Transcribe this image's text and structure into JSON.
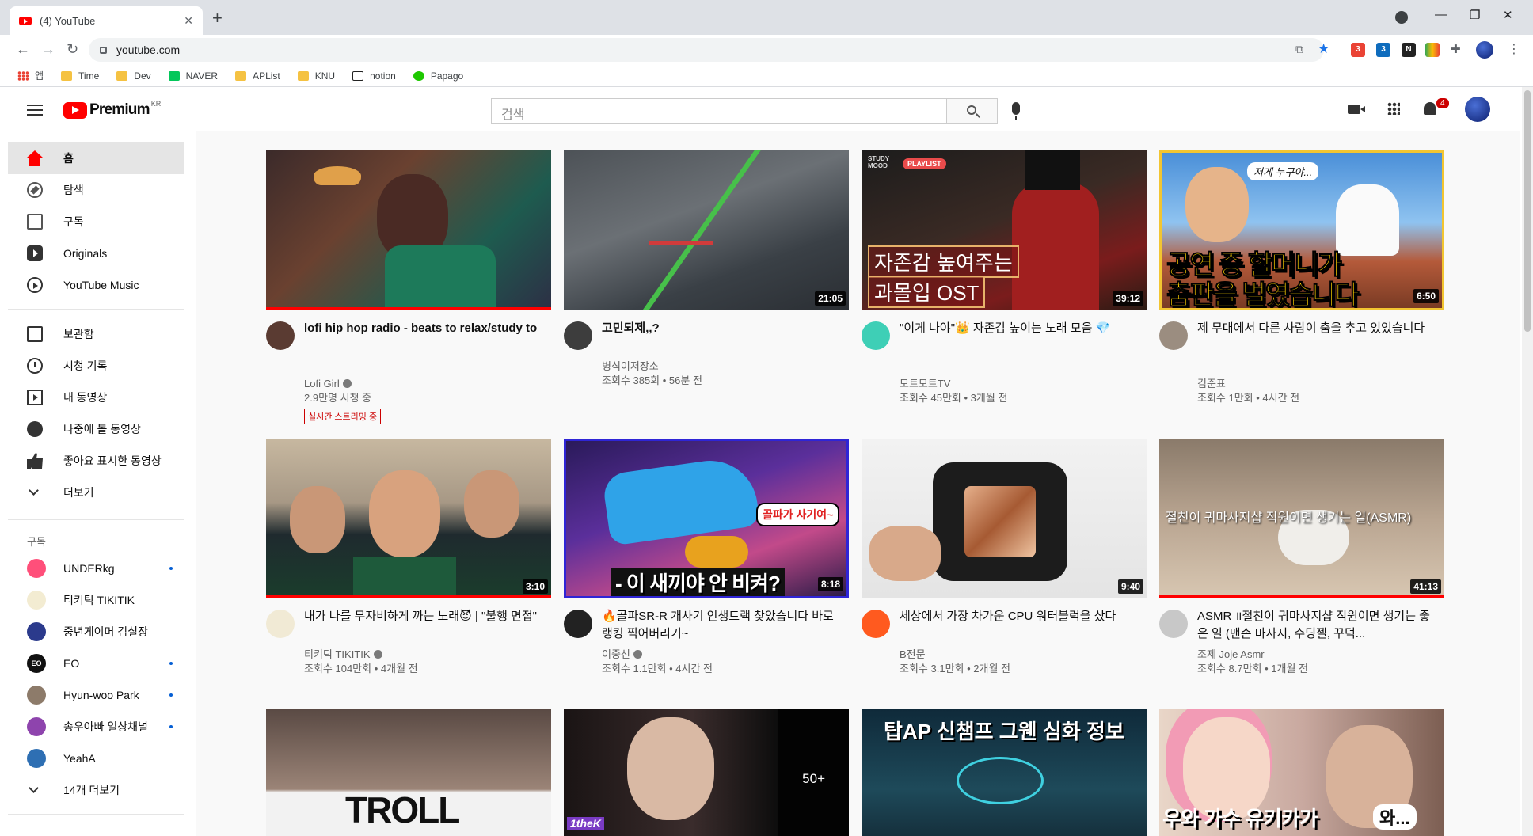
{
  "browser": {
    "tab_title": "(4) YouTube",
    "url": "youtube.com",
    "bookmarks": [
      {
        "label": "앱"
      },
      {
        "label": "Time"
      },
      {
        "label": "Dev"
      },
      {
        "label": "NAVER"
      },
      {
        "label": "APList"
      },
      {
        "label": "KNU"
      },
      {
        "label": "notion"
      },
      {
        "label": "Papago"
      }
    ],
    "extension_badges": {
      "gmail": "3",
      "outlook": "3"
    }
  },
  "masthead": {
    "logo_text": "Premium",
    "region": "KR",
    "search_placeholder": "검색",
    "notification_count": "4"
  },
  "sidebar": {
    "main_items": [
      {
        "label": "홈"
      },
      {
        "label": "탐색"
      },
      {
        "label": "구독"
      },
      {
        "label": "Originals"
      },
      {
        "label": "YouTube Music"
      }
    ],
    "library_items": [
      {
        "label": "보관함"
      },
      {
        "label": "시청 기록"
      },
      {
        "label": "내 동영상"
      },
      {
        "label": "나중에 볼 동영상"
      },
      {
        "label": "좋아요 표시한 동영상"
      },
      {
        "label": "더보기"
      }
    ],
    "subscriptions_heading": "구독",
    "subscriptions": [
      {
        "label": "UNDERkg",
        "new": true
      },
      {
        "label": "티키틱 TIKITIK",
        "new": false
      },
      {
        "label": "중년게이머 김실장",
        "new": false
      },
      {
        "label": "EO",
        "new": true
      },
      {
        "label": "Hyun-woo Park",
        "new": true
      },
      {
        "label": "송우아빠 일상채널",
        "new": true
      },
      {
        "label": "YeahA",
        "new": false
      }
    ],
    "more_subscriptions": "14개 더보기"
  },
  "videos": [
    {
      "title": "lofi hip hop radio - beats to relax/study to",
      "channel": "Lofi Girl",
      "stats": "2.9만명 시청 중",
      "live_badge": "실시간 스트리밍 중"
    },
    {
      "title": "고민되제,,?",
      "channel": "병식이저장소",
      "stats": "조회수 385회 • 56분 전",
      "duration": "21:05"
    },
    {
      "title": "\"이게 나야\"👑 자존감 높이는 노래 모음 💎",
      "channel": "모트모트TV",
      "stats": "조회수 45만회 • 3개월 전",
      "duration": "39:12",
      "thumb_tag": "PLAYLIST",
      "thumb_label": "STUDY MOOD",
      "thumb_line1": "자존감 높여주는",
      "thumb_line2": "과몰입 OST"
    },
    {
      "title": "제 무대에서 다른 사람이 춤을 추고 있었습니다",
      "channel": "김준표",
      "stats": "조회수 1만회 • 4시간 전",
      "duration": "6:50",
      "thumb_line1": "공연 중 할머니가",
      "thumb_line2": "춤판을 벌였습니다",
      "thumb_bubble": "저게 누구야..."
    },
    {
      "title": "내가 나를 무자비하게 까는 노래😈 | \"불행 면접\"",
      "channel": "티키틱 TIKITIK",
      "stats": "조회수 104만회 • 4개월 전",
      "duration": "3:10"
    },
    {
      "title": "🔥골파SR-R 개사기 인생트랙 찾았습니다 바로 랭킹 찍어버리기~",
      "channel": "이중선",
      "stats": "조회수 1.1만회 • 4시간 전",
      "duration": "8:18",
      "thumb_line1": "- 이 새끼야 안 비켜?",
      "thumb_bubble": "골파가 사기여~"
    },
    {
      "title": "세상에서 가장 차가운 CPU 워터블럭을 샀다",
      "channel": "B전문",
      "stats": "조회수 3.1만회 • 2개월 전",
      "duration": "9:40"
    },
    {
      "title": "ASMR ॥절친이 귀마사지샵 직원이면 생기는 좋은 일 (맨손 마사지, 수딩젤, 꾸덕...",
      "channel": "조제 Joje Asmr",
      "stats": "조회수 8.7만회 • 1개월 전",
      "duration": "41:13",
      "thumb_line1": "절친이 귀마사지샵 직원이면 생기는 일(ASMR)"
    },
    {
      "title": "",
      "thumb_line1": "TROLL"
    },
    {
      "title": "",
      "thumb_count": "50+",
      "thumb_brand": "1theK"
    },
    {
      "title": "",
      "thumb_line1": "탑AP 신챔프 그웬 심화 정보"
    },
    {
      "title": "",
      "thumb_line1": "우와 가수 유키카가",
      "thumb_bubble": "와..."
    }
  ],
  "icons": {
    "home": "home-icon",
    "explore": "compass-icon",
    "subscriptions": "subscriptions-icon",
    "originals": "originals-icon",
    "music": "youtube-music-icon",
    "library": "library-icon",
    "history": "history-icon",
    "my_videos": "my-videos-icon",
    "watch_later": "watch-later-icon",
    "liked": "thumbs-up-icon",
    "more": "chevron-down-icon"
  },
  "colors": {
    "brand": "#ff0000",
    "link": "#065fd4",
    "live": "#cc0000",
    "feed_bg": "#f9f9f9"
  }
}
